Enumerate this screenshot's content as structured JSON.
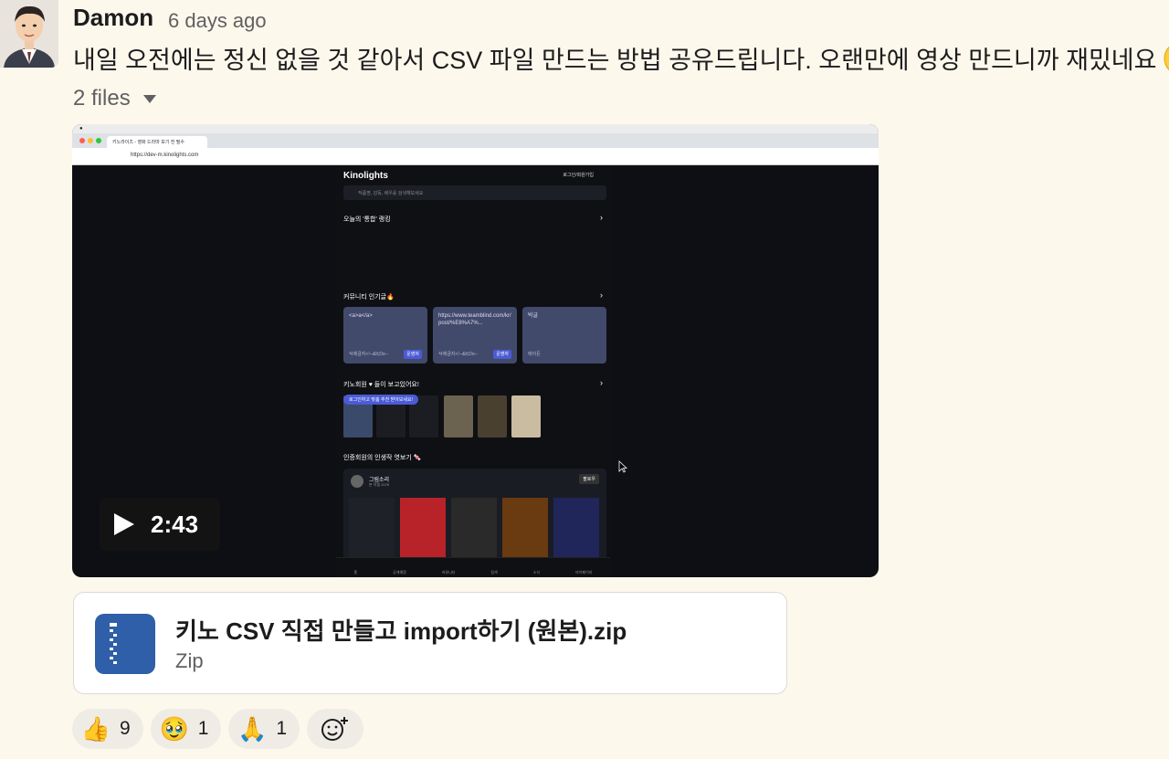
{
  "message": {
    "author": "Damon",
    "timestamp": "6 days ago",
    "text": "내일 오전에는 정신 없을 것 같아서 CSV 파일 만드는 방법 공유드립니다. 오랜만에 영상 만드니까 재밌네요",
    "trailing_emoji": "grinning-face",
    "files_label": "2 files"
  },
  "video": {
    "duration": "2:43",
    "browser": {
      "tab_title": "키노라이츠 - 영화 드라마 보기 전 필수",
      "url": "https://dev-m.kinolights.com"
    },
    "page": {
      "logo": "Kinolights",
      "login": "로그인/회원가입",
      "search_placeholder": "작품명, 감독, 배우를 검색해보세요",
      "section_ranking": "오늘의 '통합' 랭킹",
      "section_community": "커뮤니티 인기글🔥",
      "cards": [
        {
          "title": "<a>a</a>",
          "author": "삭제금지<!--&lt;Do--",
          "badge": "운영자"
        },
        {
          "title": "https://www.teamblind.com/kr/post/%E8%A7%...",
          "author": "삭제금지<!--&lt;Do--",
          "badge": "운영자"
        },
        {
          "title": "박글",
          "author": "애이든",
          "badge": ""
        }
      ],
      "section_members": "키노회원 ♥ 들이 보고있어요!",
      "tooltip": "로그인하고 맞춤 추천 받아보세요!",
      "section_lifetime": "인증회원의 인생작 엿보기 🍬",
      "profile_name": "그림소리",
      "profile_sub": "본 작품 2076",
      "follow": "팔로우",
      "nav": [
        "홈",
        "공개예정",
        "커뮤니티",
        "탐색",
        "소식",
        "마이페이지"
      ]
    }
  },
  "attachment": {
    "name": "키노 CSV 직접 만들고 import하기 (원본).zip",
    "type": "Zip",
    "icon": "zip-file-icon"
  },
  "reactions": [
    {
      "emoji": "👍",
      "icon": "thumbs-up-icon",
      "count": "9"
    },
    {
      "emoji": "🥹",
      "icon": "holding-back-tears-icon",
      "count": "1"
    },
    {
      "emoji": "🙏",
      "icon": "folded-hands-icon",
      "count": "1"
    }
  ],
  "colors": {
    "background": "#fdf8ec",
    "zip": "#2e5fa8",
    "card": "#424a6c",
    "badge": "#4b5bd6"
  }
}
